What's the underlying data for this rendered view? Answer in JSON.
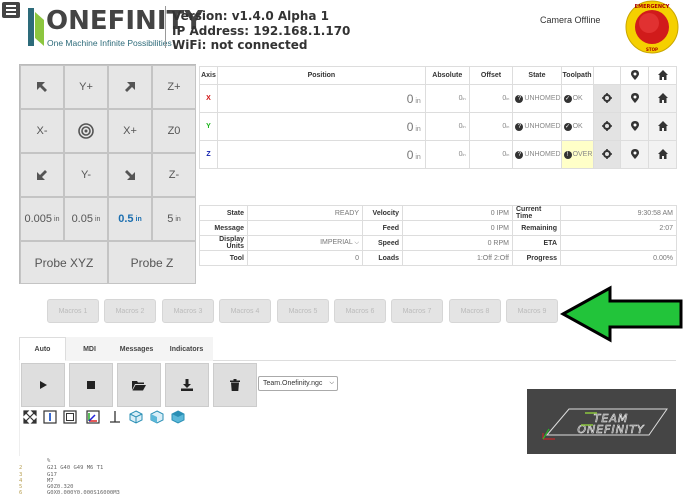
{
  "header": {
    "logo_word": "ONEFINITY",
    "logo_tagline": "One Machine Infinite Possibilities",
    "version": "Version: v1.4.0 Alpha 1",
    "ip": "IP Address: 192.168.1.170",
    "wifi": "WiFi: not connected",
    "camera": "Camera Offline",
    "estop_label_top": "EMERGENCY",
    "estop_label_bottom": "STOP"
  },
  "jog": {
    "buttons": [
      "Y+",
      "X-",
      "X+",
      "Z+",
      "Z0",
      "Y-",
      "Z-"
    ],
    "steps": [
      {
        "value": "0.005",
        "unit": "in"
      },
      {
        "value": "0.05",
        "unit": "in"
      },
      {
        "value": "0.5",
        "unit": "in"
      },
      {
        "value": "5",
        "unit": "in"
      }
    ],
    "probe_xyz": "Probe XYZ",
    "probe_z": "Probe Z"
  },
  "axes_table": {
    "headers": [
      "Axis",
      "Position",
      "Absolute",
      "Offset",
      "State",
      "Toolpath"
    ],
    "rows": [
      {
        "axis": "X",
        "color": "#d11010",
        "position": "0",
        "unit": "in",
        "absolute": "0",
        "offset": "0",
        "state": "UNHOMED",
        "toolpath": "OK"
      },
      {
        "axis": "Y",
        "color": "#18b418",
        "position": "0",
        "unit": "in",
        "absolute": "0",
        "offset": "0",
        "state": "UNHOMED",
        "toolpath": "OK"
      },
      {
        "axis": "Z",
        "color": "#1020b0",
        "position": "0",
        "unit": "in",
        "absolute": "0",
        "offset": "0",
        "state": "UNHOMED",
        "toolpath": "OVER"
      }
    ],
    "unit_small": "in"
  },
  "status": {
    "state_label": "State",
    "state": "READY",
    "message_label": "Message",
    "message": "",
    "units_label": "Display Units",
    "units": "IMPERIAL",
    "tool_label": "Tool",
    "tool": "0",
    "velocity_label": "Velocity",
    "velocity": "0 IPM",
    "feed_label": "Feed",
    "feed": "0 IPM",
    "speed_label": "Speed",
    "speed": "0 RPM",
    "loads_label": "Loads",
    "loads": "1:Off 2:Off",
    "time_label": "Current Time",
    "time": "9:30:58 AM",
    "remaining_label": "Remaining",
    "remaining": "2:07",
    "eta_label": "ETA",
    "eta": "",
    "progress_label": "Progress",
    "progress": "0.00%"
  },
  "macros": [
    "Macros 1",
    "Macros 2",
    "Macros 3",
    "Macros 4",
    "Macros 5",
    "Macros 6",
    "Macros 7",
    "Macros 8",
    "Macros 9"
  ],
  "arrow_color": "#22c43a",
  "tabs": [
    "Auto",
    "MDI",
    "Messages",
    "Indicators"
  ],
  "file": {
    "selected": "Team.Onefinity.ngc"
  },
  "preview": {
    "line1": "TEAM",
    "line2": "ONEFINITY"
  },
  "gcode": {
    "line_numbers": [
      "2",
      "3",
      "4",
      "5",
      "6"
    ],
    "lines": [
      "%",
      "G21 G40 G49 M6 T1",
      "G17",
      "M7",
      "G0Z0.320",
      "G0X0.000Y0.000S16000M3"
    ]
  }
}
